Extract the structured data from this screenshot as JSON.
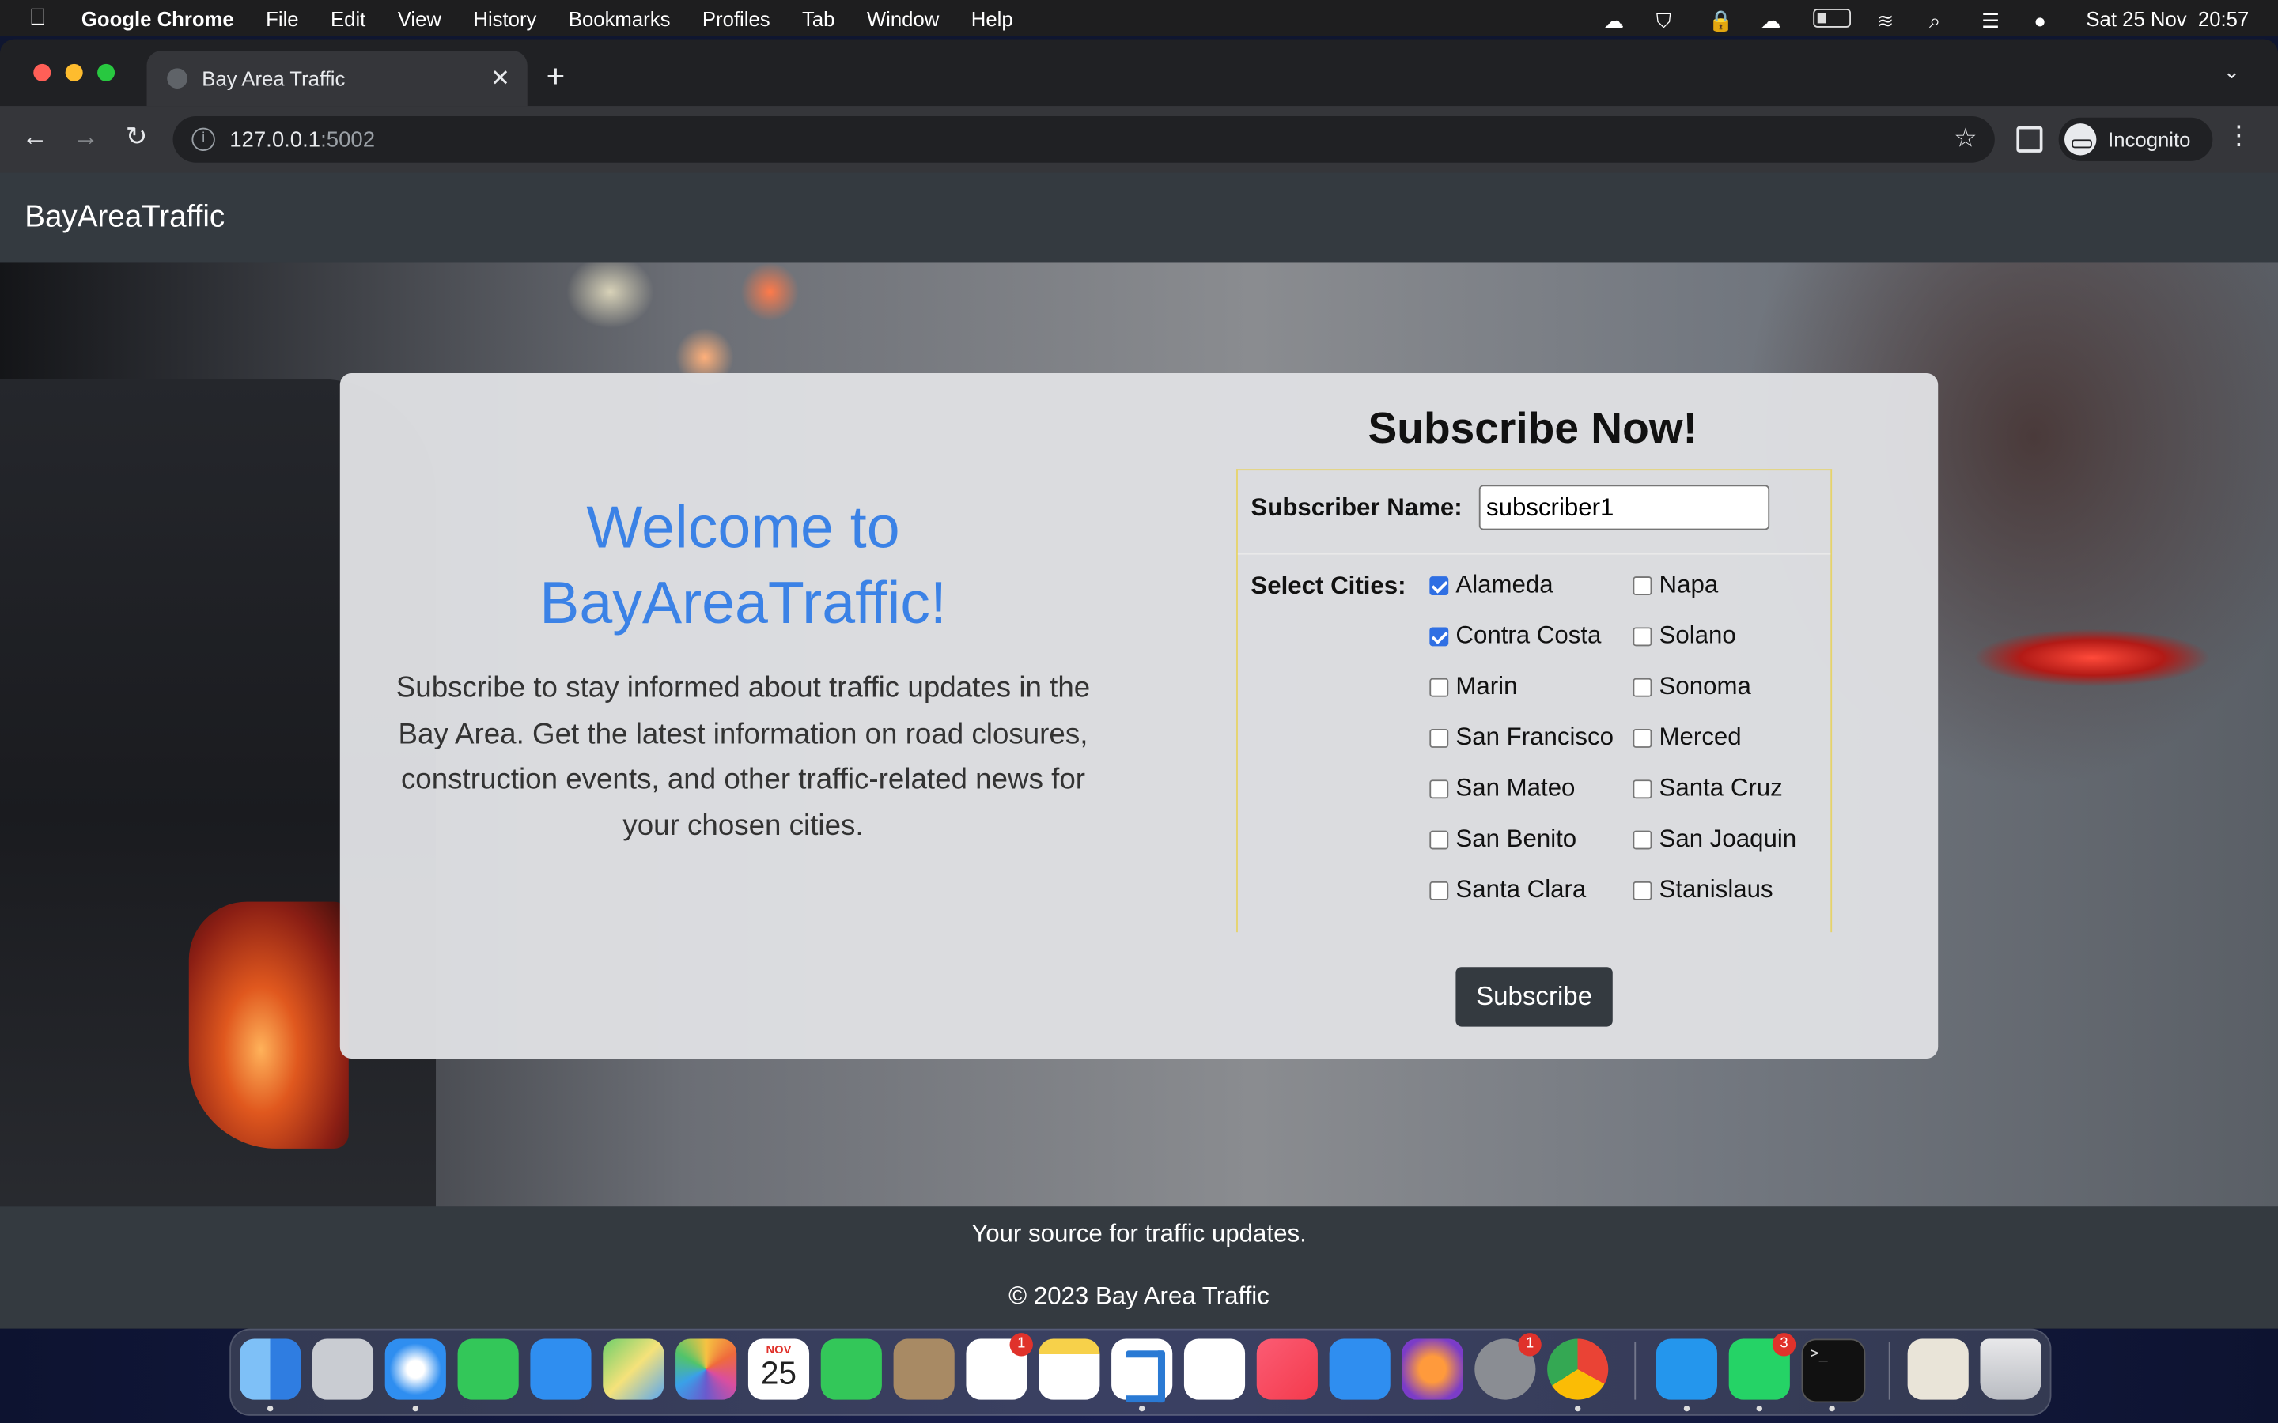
{
  "menubar": {
    "app": "Google Chrome",
    "items": [
      "File",
      "Edit",
      "View",
      "History",
      "Bookmarks",
      "Profiles",
      "Tab",
      "Window",
      "Help"
    ],
    "clock": "Sat 25 Nov  20:57"
  },
  "browser": {
    "tab_title": "Bay Area Traffic",
    "url_host": "127.0.0.1",
    "url_port": ":5002",
    "profile_label": "Incognito"
  },
  "site": {
    "brand": "BayAreaTraffic",
    "welcome_line1": "Welcome to",
    "welcome_line2": "BayAreaTraffic!",
    "intro": "Subscribe to stay informed about traffic updates in the Bay Area. Get the latest information on road closures, construction events, and other traffic-related news for your chosen cities.",
    "form_title": "Subscribe Now!",
    "name_label": "Subscriber Name:",
    "name_value": "subscriber1",
    "cities_label": "Select Cities:",
    "cities": [
      {
        "name": "Alameda",
        "checked": true
      },
      {
        "name": "Napa",
        "checked": false
      },
      {
        "name": "Contra Costa",
        "checked": true
      },
      {
        "name": "Solano",
        "checked": false
      },
      {
        "name": "Marin",
        "checked": false
      },
      {
        "name": "Sonoma",
        "checked": false
      },
      {
        "name": "San Francisco",
        "checked": false
      },
      {
        "name": "Merced",
        "checked": false
      },
      {
        "name": "San Mateo",
        "checked": false
      },
      {
        "name": "Santa Cruz",
        "checked": false
      },
      {
        "name": "San Benito",
        "checked": false
      },
      {
        "name": "San Joaquin",
        "checked": false
      },
      {
        "name": "Santa Clara",
        "checked": false
      },
      {
        "name": "Stanislaus",
        "checked": false
      }
    ],
    "subscribe_label": "Subscribe",
    "footer_line1": "Your source for traffic updates.",
    "footer_line2": "© 2023 Bay Area Traffic"
  },
  "dock": {
    "calendar_month": "NOV",
    "calendar_day": "25",
    "badges": {
      "reminders": "1",
      "settings": "1",
      "whatsapp": "3"
    }
  },
  "colors": {
    "accent_blue": "#3b82e6",
    "navbar": "#343a40",
    "checkbox_checked": "#2f6fe3"
  }
}
